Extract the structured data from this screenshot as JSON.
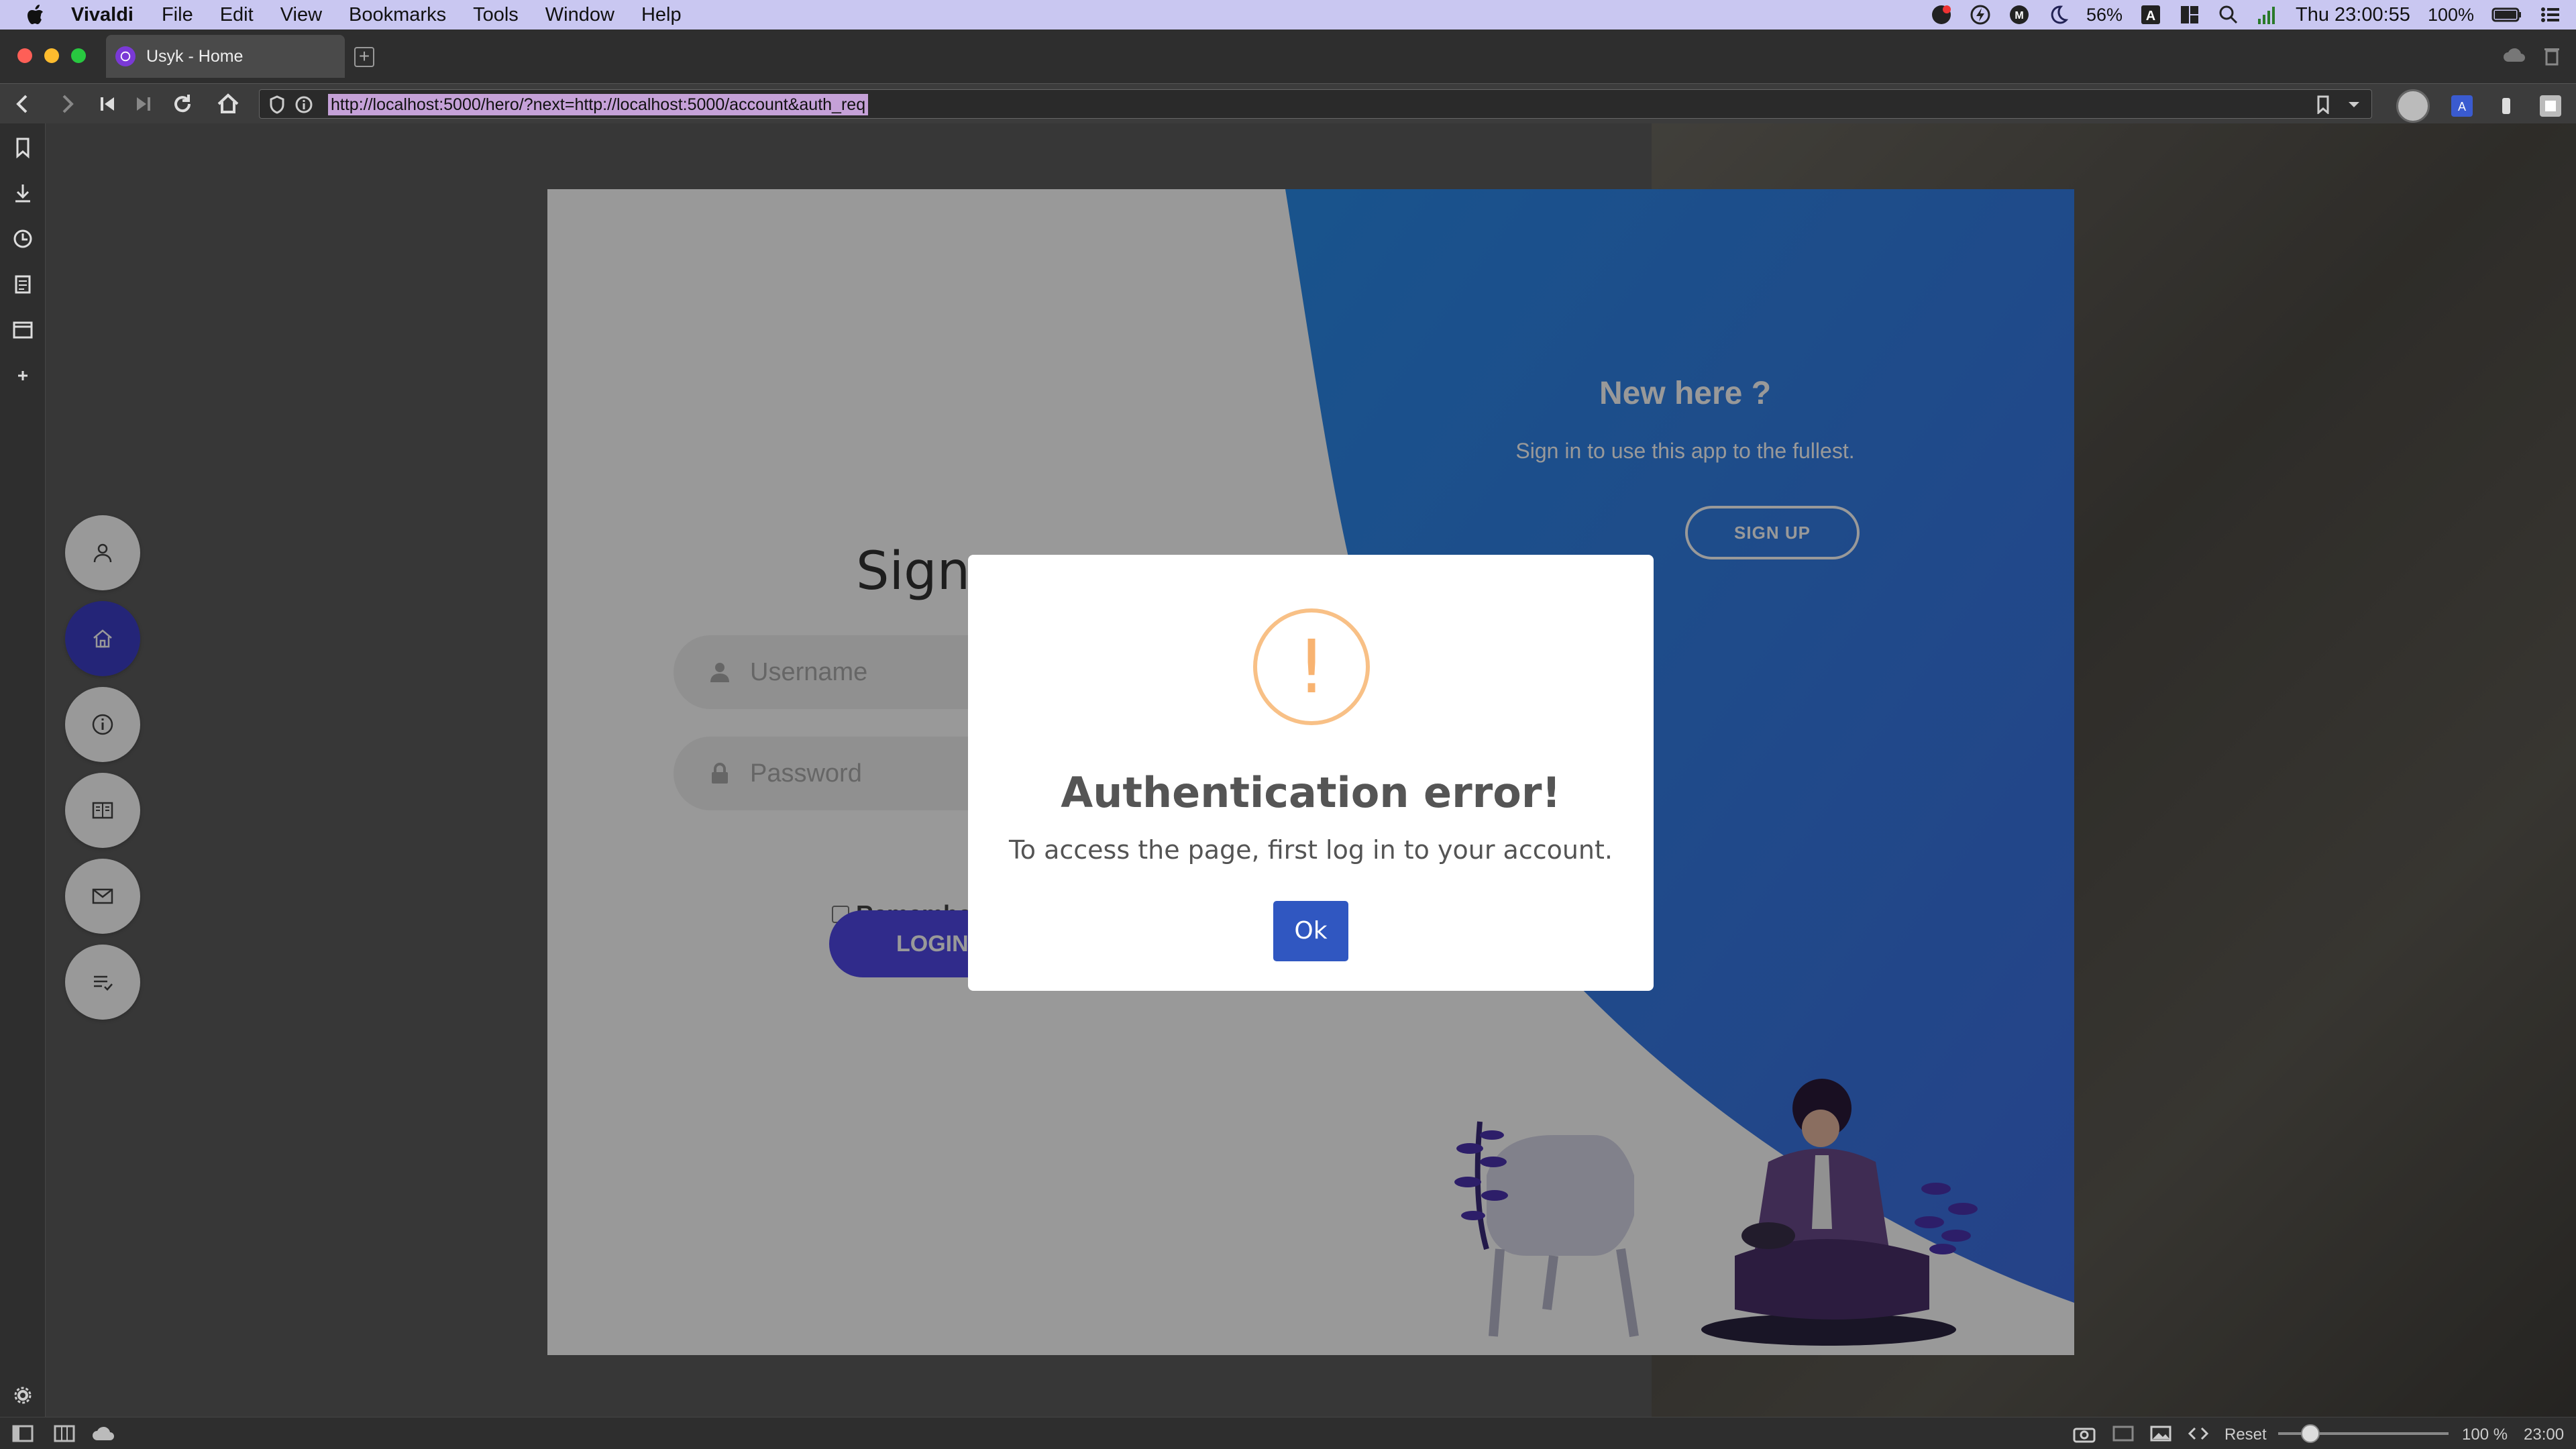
{
  "menubar": {
    "app_name": "Vivaldi",
    "items": [
      "File",
      "Edit",
      "View",
      "Bookmarks",
      "Tools",
      "Window",
      "Help"
    ],
    "battery_percent_small": "56%",
    "clock": "Thu 23:00:55",
    "battery": "100%"
  },
  "tab": {
    "title": "Usyk - Home"
  },
  "address": {
    "url": "http://localhost:5000/hero/?next=http://localhost:5000/account&auth_req"
  },
  "page": {
    "signin_heading": "Sign",
    "username_placeholder": "Username",
    "password_placeholder": "Password",
    "remember_label": "Remembe",
    "login_label": "LOGIN",
    "new_here_title": "New here ?",
    "new_here_text": "Sign in to use this app to the fullest.",
    "signup_label": "SIGN UP"
  },
  "floating_nav": {
    "items": [
      "user-icon",
      "home-icon",
      "info-icon",
      "book-icon",
      "mail-icon",
      "list-check-icon"
    ],
    "active": "home-icon"
  },
  "modal": {
    "icon_glyph": "!",
    "title": "Authentication error!",
    "message": "To access the page, first log in to your account.",
    "ok_label": "Ok"
  },
  "statusbar": {
    "reset_label": "Reset",
    "zoom": "100 %",
    "time": "23:00"
  },
  "colors": {
    "accent_blue": "#3057c1",
    "nav_active": "#3c3fc8",
    "login_button": "#5149e8",
    "warning": "#f8c086",
    "menubar": "#c9c7f1"
  }
}
